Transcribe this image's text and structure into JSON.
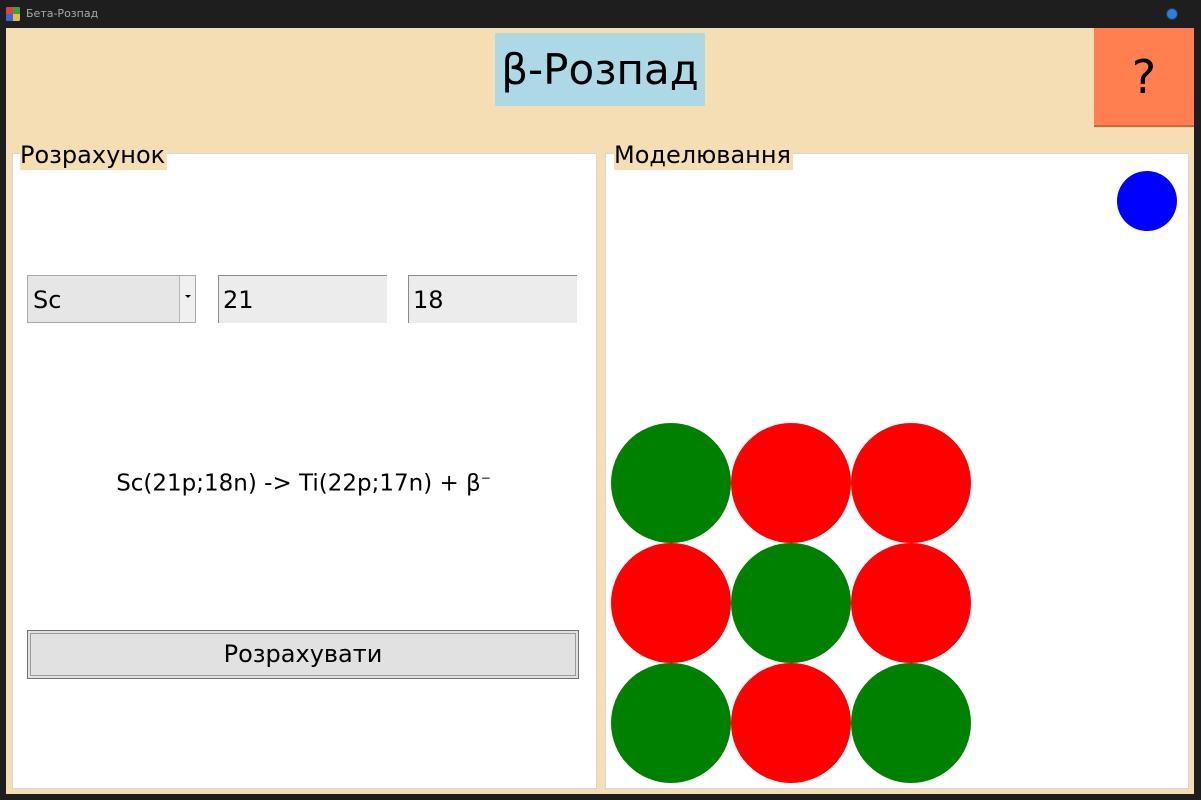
{
  "window": {
    "title": "Бета-Розпад"
  },
  "header": {
    "title": "β-Розпад",
    "help_label": "?"
  },
  "calculation": {
    "group_title": "Розрахунок",
    "element_select": {
      "value": "Sc",
      "options": [
        "Sc"
      ]
    },
    "protons_value": "21",
    "neutrons_value": "18",
    "equation_text": "Sc(21p;18n) -> Ti(22p;17n) + β",
    "equation_superscript": "−",
    "calculate_label": "Розрахувати"
  },
  "modeling": {
    "group_title": "Моделювання",
    "electron_color": "#0000ff",
    "nucleus_grid": [
      [
        "neutron",
        "proton",
        "proton"
      ],
      [
        "proton",
        "neutron",
        "proton"
      ],
      [
        "neutron",
        "proton",
        "neutron"
      ]
    ],
    "colors": {
      "proton": "#ff0000",
      "neutron": "#008000"
    }
  },
  "colors": {
    "header_background": "#f5deb3",
    "title_background": "#add8e6",
    "help_background": "#ff7f50"
  }
}
